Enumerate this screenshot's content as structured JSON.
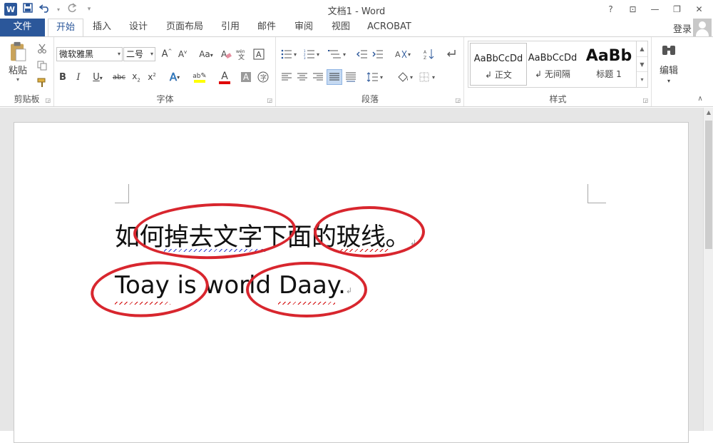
{
  "titlebar": {
    "app_icon": "W",
    "title": "文档1 - Word",
    "help": "?",
    "ribbon_display": "⊡",
    "minimize": "—",
    "restore": "❐",
    "close": "✕"
  },
  "tabs": [
    "文件",
    "开始",
    "插入",
    "设计",
    "页面布局",
    "引用",
    "邮件",
    "审阅",
    "视图",
    "ACROBAT"
  ],
  "signin": "登录",
  "clipboard": {
    "paste": "粘贴",
    "label": "剪贴板"
  },
  "font": {
    "family": "微软雅黑",
    "size": "二号",
    "label": "字体"
  },
  "paragraph": {
    "label": "段落"
  },
  "styles": {
    "label": "样式",
    "items": [
      {
        "preview": "AaBbCcDd",
        "name": "正文"
      },
      {
        "preview": "AaBbCcDd",
        "name": "无间隔"
      },
      {
        "preview": "AaBb",
        "name": "标题 1"
      }
    ]
  },
  "editing": {
    "label": "编辑"
  },
  "document": {
    "line1": "如何掉去文字下面的玻线。",
    "line2": "Toay is world Daay."
  },
  "colors": {
    "accent": "#2b579a",
    "annotation": "#d8262e",
    "spell_red": "#d00000",
    "grammar_blue": "#2a3bd0",
    "highlight": "#ffff00",
    "font_red": "#e00000"
  }
}
